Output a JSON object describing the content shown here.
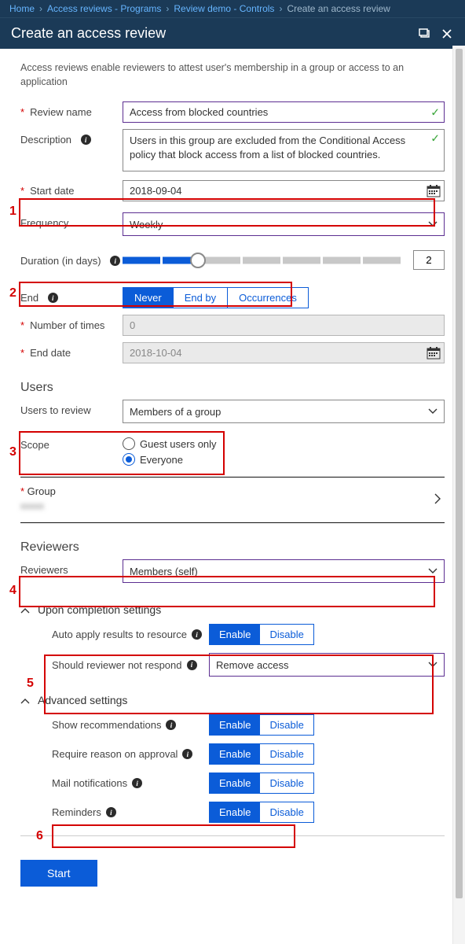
{
  "breadcrumb": {
    "home": "Home",
    "programs": "Access reviews - Programs",
    "controls": "Review demo - Controls",
    "current": "Create an access review"
  },
  "header": {
    "title": "Create an access review"
  },
  "intro": "Access reviews enable reviewers to attest user's membership in a group or access to an application",
  "reviewName": {
    "label": "Review name",
    "value": "Access from blocked countries"
  },
  "description": {
    "label": "Description",
    "value": "Users in this group are excluded from the Conditional Access policy that block access from a list of blocked countries."
  },
  "startDate": {
    "label": "Start date",
    "value": "2018-09-04"
  },
  "frequency": {
    "label": "Frequency",
    "value": "Weekly"
  },
  "duration": {
    "label": "Duration (in days)",
    "value": "2",
    "fillPercent": 27
  },
  "end": {
    "label": "End",
    "options": {
      "never": "Never",
      "endBy": "End by",
      "occurrences": "Occurrences"
    },
    "selected": "never"
  },
  "numTimes": {
    "label": "Number of times",
    "value": "0"
  },
  "endDate": {
    "label": "End date",
    "value": "2018-10-04"
  },
  "usersSection": "Users",
  "usersToReview": {
    "label": "Users to review",
    "value": "Members of a group"
  },
  "scope": {
    "label": "Scope",
    "guest": "Guest users only",
    "everyone": "Everyone",
    "selected": "everyone"
  },
  "group": {
    "label": "Group",
    "value": "xxxxx"
  },
  "reviewersSection": "Reviewers",
  "reviewers": {
    "label": "Reviewers",
    "value": "Members (self)"
  },
  "completion": {
    "header": "Upon completion settings",
    "autoApply": {
      "label": "Auto apply results to resource",
      "enable": "Enable",
      "disable": "Disable"
    },
    "notRespond": {
      "label": "Should reviewer not respond",
      "value": "Remove access"
    }
  },
  "advanced": {
    "header": "Advanced settings",
    "showRec": {
      "label": "Show recommendations",
      "enable": "Enable",
      "disable": "Disable"
    },
    "reqReason": {
      "label": "Require reason on approval",
      "enable": "Enable",
      "disable": "Disable"
    },
    "mail": {
      "label": "Mail notifications",
      "enable": "Enable",
      "disable": "Disable"
    },
    "reminders": {
      "label": "Reminders",
      "enable": "Enable",
      "disable": "Disable"
    }
  },
  "startBtn": "Start",
  "callouts": {
    "n1": "1",
    "n2": "2",
    "n3": "3",
    "n4": "4",
    "n5": "5",
    "n6": "6"
  }
}
